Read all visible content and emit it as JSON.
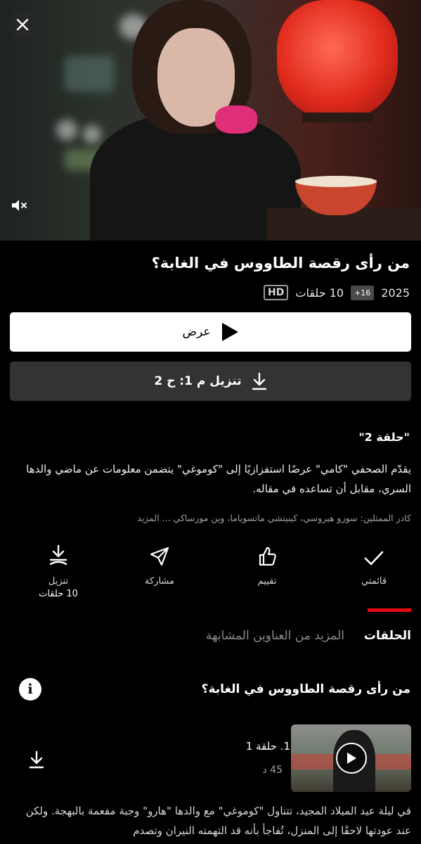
{
  "show": {
    "title": "من رأى رقصة الطاووس في الغابة؟",
    "year": "2025",
    "age_rating": "16+",
    "episodes_count": "10 حلقات",
    "quality": "HD"
  },
  "buttons": {
    "play": "عرض",
    "download": "تنزيل م 1: ح 2"
  },
  "episode": {
    "title": "\"حلقة 2\"",
    "synopsis": "يقدّم الصحفي \"كامي\" عرضًا استفزازيًا إلى \"كوموغي\" يتضمن معلومات عن ماضي والدها السري، مقابل أن تساعده في مقاله.",
    "cast": "كادر الممثلين: سوزو هيروسي، كينيتشي ماتسوياما، وين مورساكي ... المزيد"
  },
  "actions": {
    "my_list": "قائمتي",
    "rate": "تقييم",
    "share": "مشاركة",
    "download_line1": "تنزيل",
    "download_line2": "10 حلقات"
  },
  "tabs": {
    "episodes": "الحلقات",
    "more_like_this": "المزيد من العناوين المشابهة"
  },
  "episodes_section": {
    "series_name": "من رأى رقصة الطاووس في الغابة؟",
    "items": [
      {
        "title": "1. حلقة 1",
        "duration": "45 د",
        "description": "في ليلة عيد الميلاد المجيد، تتناول \"كوموغي\" مع والدها \"هارو\" وجبة مفعمة بالبهجة. ولكن عند عودتها لاحقًا إلى المنزل، تُفاجأ بأنه قد التهمته النيران وتصدم"
      }
    ]
  },
  "colors": {
    "accent": "#e50914",
    "background": "#000000",
    "secondary_button": "#333333"
  },
  "icons": [
    "close-icon",
    "cast-icon",
    "mute-icon",
    "play-icon",
    "download-icon",
    "check-icon",
    "thumbs-up-icon",
    "share-icon",
    "info-icon"
  ]
}
